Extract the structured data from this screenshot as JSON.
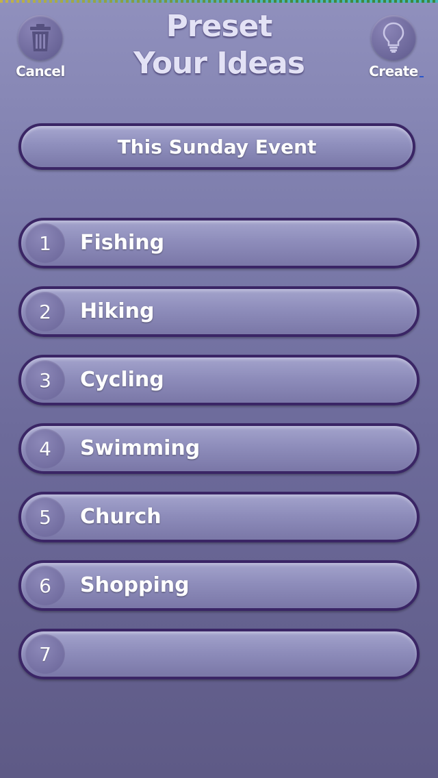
{
  "header": {
    "title_line1": "Preset",
    "title_line2": "Your Ideas",
    "cancel_label": "Cancel",
    "create_label": "Create",
    "cancel_icon": "trash-icon",
    "create_icon": "lightbulb-icon"
  },
  "event": {
    "label": "This Sunday Event"
  },
  "items": [
    {
      "number": "1",
      "label": "Fishing"
    },
    {
      "number": "2",
      "label": "Hiking"
    },
    {
      "number": "3",
      "label": "Cycling"
    },
    {
      "number": "4",
      "label": "Swimming"
    },
    {
      "number": "5",
      "label": "Church"
    },
    {
      "number": "6",
      "label": "Shopping"
    },
    {
      "number": "7",
      "label": ""
    }
  ],
  "colors": {
    "background_top": "#9090bd",
    "background_bottom": "#5e5a86",
    "bar_border": "#3a2565",
    "text": "#ffffff"
  }
}
